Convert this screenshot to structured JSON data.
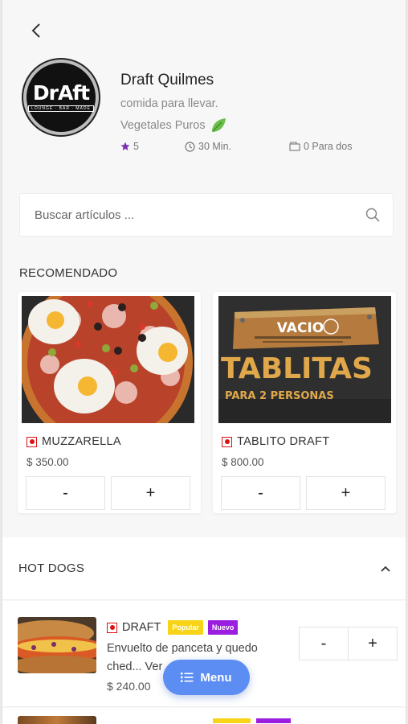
{
  "store": {
    "logo_text": "DrAft",
    "logo_subtext": "LOUNGE · BAR · MADE",
    "name": "Draft Quilmes",
    "description": "comida para llevar.",
    "tag": "Vegetales Puros",
    "rating": "5",
    "delivery_time": "30 Min.",
    "cost_for_two": "0 Para dos"
  },
  "search": {
    "placeholder": "Buscar artículos ..."
  },
  "recommended": {
    "title": "RECOMENDADO",
    "items": [
      {
        "name": "MUZZARELLA",
        "price": "$ 350.00",
        "minus": "-",
        "plus": "+"
      },
      {
        "name": "TABLITO DRAFT",
        "price": "$ 800.00",
        "minus": "-",
        "plus": "+",
        "image_text_top": "VACIO",
        "image_text_main": "TABLITAS",
        "image_text_sub": "PARA 2 PERSONAS"
      }
    ]
  },
  "category": {
    "title": "HOT DOGS",
    "items": [
      {
        "name": "DRAFT",
        "badge_popular": "Popular",
        "badge_new": "Nuevo",
        "description": "Envuelto de panceta y quedo ched... Ver",
        "price": "$ 240.00",
        "minus": "-",
        "plus": "+"
      }
    ]
  },
  "menu_button": {
    "label": "Menu"
  },
  "colors": {
    "accent": "#5b8df2",
    "popular": "#f7d417",
    "new": "#9b1ee0",
    "veg_mark": "#dd1111",
    "star": "#7b2fb5"
  }
}
